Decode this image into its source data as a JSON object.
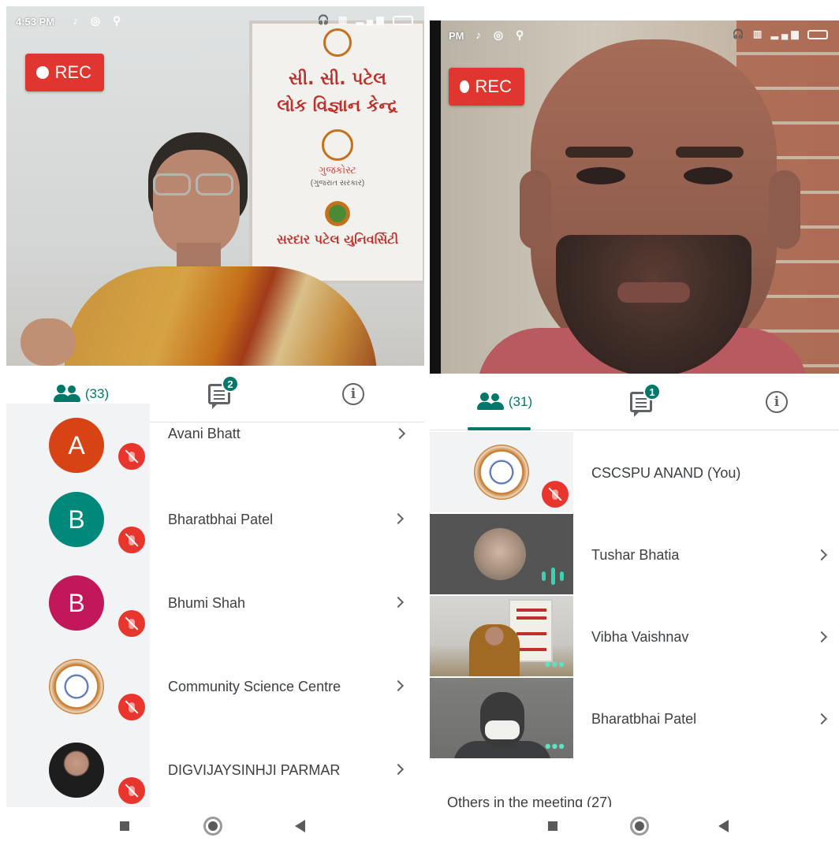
{
  "left": {
    "status": {
      "time": "4:53 PM"
    },
    "rec_label": "REC",
    "banner": {
      "line1": "સી. સી. પટેલ",
      "line2": "લોક વિજ્ઞાન કેન્દ્ર",
      "line3": "ગુજકોસ્ટ",
      "line4": "(ગુજરાત સરકાર)",
      "line5": "સરદાર પટેલ યુનિવર્સિટી"
    },
    "tabs": {
      "people_count": "(33)",
      "chat_badge": "2"
    },
    "participants": [
      {
        "initial": "A",
        "name": "Avani Bhatt",
        "color": "#d84315"
      },
      {
        "initial": "B",
        "name": "Bharatbhai Patel",
        "color": "#00897b"
      },
      {
        "initial": "B",
        "name": "Bhumi Shah",
        "color": "#c2185b"
      },
      {
        "initial": "",
        "name": "Community Science Centre",
        "color": "emblem"
      },
      {
        "initial": "",
        "name": "DIGVIJAYSINHJI PARMAR",
        "color": "photo"
      }
    ]
  },
  "right": {
    "status": {
      "time": "PM"
    },
    "rec_label": "REC",
    "tabs": {
      "people_count": "(31)",
      "chat_badge": "1"
    },
    "participants": [
      {
        "name": "CSCSPU ANAND (You)"
      },
      {
        "name": "Tushar Bhatia"
      },
      {
        "name": "Vibha Vaishnav"
      },
      {
        "name": "Bharatbhai Patel"
      }
    ],
    "others_label": "Others in the meeting (27)"
  },
  "colors": {
    "accent": "#00796b",
    "rec": "#e0362f",
    "mic_off": "#e8352d"
  }
}
